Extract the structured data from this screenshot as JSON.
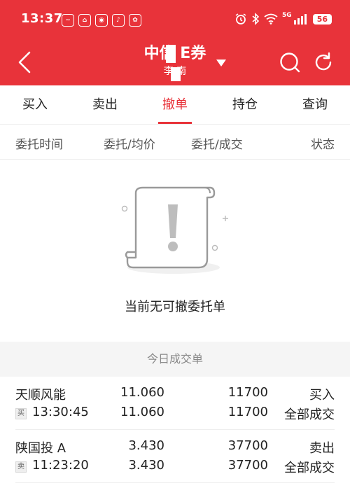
{
  "status_bar": {
    "time": "13:37",
    "notif_icons": [
      "stock-app-icon",
      "home-app-icon",
      "weibo-icon",
      "music-icon",
      "gift-icon"
    ],
    "net_label": "5G",
    "battery": "56"
  },
  "header": {
    "title": "中信证券",
    "title_visible": "中信 E券",
    "subtitle": "李 南",
    "bg_color": "#e8333a"
  },
  "tabs": [
    {
      "label": "买入",
      "active": false
    },
    {
      "label": "卖出",
      "active": false
    },
    {
      "label": "撤单",
      "active": true
    },
    {
      "label": "持仓",
      "active": false
    },
    {
      "label": "查询",
      "active": false
    }
  ],
  "columns": [
    "委托时间",
    "委托/均价",
    "委托/成交",
    "状态"
  ],
  "empty_state": {
    "text": "当前无可撤委托单",
    "icon": "empty-document-exclamation-icon"
  },
  "today_section": {
    "title": "今日成交单"
  },
  "trades": [
    {
      "name": "天顺风能",
      "badge": "买",
      "time": "13:30:45",
      "price1": "11.060",
      "price2": "11.060",
      "qty1": "11700",
      "qty2": "11700",
      "side": "买入",
      "status": "全部成交"
    },
    {
      "name": "陕国投 A",
      "badge": "卖",
      "time": "11:23:20",
      "price1": "3.430",
      "price2": "3.430",
      "qty1": "37700",
      "qty2": "37700",
      "side": "卖出",
      "status": "全部成交"
    }
  ]
}
